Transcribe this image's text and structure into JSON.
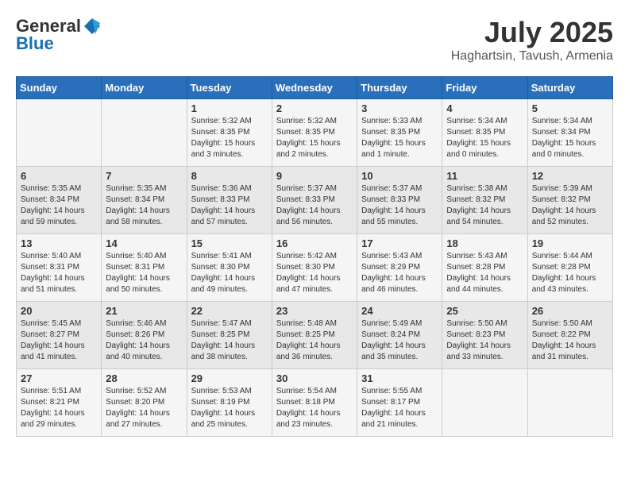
{
  "logo": {
    "general": "General",
    "blue": "Blue"
  },
  "header": {
    "month_year": "July 2025",
    "location": "Haghartsin, Tavush, Armenia"
  },
  "days_of_week": [
    "Sunday",
    "Monday",
    "Tuesday",
    "Wednesday",
    "Thursday",
    "Friday",
    "Saturday"
  ],
  "weeks": [
    [
      {
        "day": "",
        "info": ""
      },
      {
        "day": "",
        "info": ""
      },
      {
        "day": "1",
        "info": "Sunrise: 5:32 AM\nSunset: 8:35 PM\nDaylight: 15 hours and 3 minutes."
      },
      {
        "day": "2",
        "info": "Sunrise: 5:32 AM\nSunset: 8:35 PM\nDaylight: 15 hours and 2 minutes."
      },
      {
        "day": "3",
        "info": "Sunrise: 5:33 AM\nSunset: 8:35 PM\nDaylight: 15 hours and 1 minute."
      },
      {
        "day": "4",
        "info": "Sunrise: 5:34 AM\nSunset: 8:35 PM\nDaylight: 15 hours and 0 minutes."
      },
      {
        "day": "5",
        "info": "Sunrise: 5:34 AM\nSunset: 8:34 PM\nDaylight: 15 hours and 0 minutes."
      }
    ],
    [
      {
        "day": "6",
        "info": "Sunrise: 5:35 AM\nSunset: 8:34 PM\nDaylight: 14 hours and 59 minutes."
      },
      {
        "day": "7",
        "info": "Sunrise: 5:35 AM\nSunset: 8:34 PM\nDaylight: 14 hours and 58 minutes."
      },
      {
        "day": "8",
        "info": "Sunrise: 5:36 AM\nSunset: 8:33 PM\nDaylight: 14 hours and 57 minutes."
      },
      {
        "day": "9",
        "info": "Sunrise: 5:37 AM\nSunset: 8:33 PM\nDaylight: 14 hours and 56 minutes."
      },
      {
        "day": "10",
        "info": "Sunrise: 5:37 AM\nSunset: 8:33 PM\nDaylight: 14 hours and 55 minutes."
      },
      {
        "day": "11",
        "info": "Sunrise: 5:38 AM\nSunset: 8:32 PM\nDaylight: 14 hours and 54 minutes."
      },
      {
        "day": "12",
        "info": "Sunrise: 5:39 AM\nSunset: 8:32 PM\nDaylight: 14 hours and 52 minutes."
      }
    ],
    [
      {
        "day": "13",
        "info": "Sunrise: 5:40 AM\nSunset: 8:31 PM\nDaylight: 14 hours and 51 minutes."
      },
      {
        "day": "14",
        "info": "Sunrise: 5:40 AM\nSunset: 8:31 PM\nDaylight: 14 hours and 50 minutes."
      },
      {
        "day": "15",
        "info": "Sunrise: 5:41 AM\nSunset: 8:30 PM\nDaylight: 14 hours and 49 minutes."
      },
      {
        "day": "16",
        "info": "Sunrise: 5:42 AM\nSunset: 8:30 PM\nDaylight: 14 hours and 47 minutes."
      },
      {
        "day": "17",
        "info": "Sunrise: 5:43 AM\nSunset: 8:29 PM\nDaylight: 14 hours and 46 minutes."
      },
      {
        "day": "18",
        "info": "Sunrise: 5:43 AM\nSunset: 8:28 PM\nDaylight: 14 hours and 44 minutes."
      },
      {
        "day": "19",
        "info": "Sunrise: 5:44 AM\nSunset: 8:28 PM\nDaylight: 14 hours and 43 minutes."
      }
    ],
    [
      {
        "day": "20",
        "info": "Sunrise: 5:45 AM\nSunset: 8:27 PM\nDaylight: 14 hours and 41 minutes."
      },
      {
        "day": "21",
        "info": "Sunrise: 5:46 AM\nSunset: 8:26 PM\nDaylight: 14 hours and 40 minutes."
      },
      {
        "day": "22",
        "info": "Sunrise: 5:47 AM\nSunset: 8:25 PM\nDaylight: 14 hours and 38 minutes."
      },
      {
        "day": "23",
        "info": "Sunrise: 5:48 AM\nSunset: 8:25 PM\nDaylight: 14 hours and 36 minutes."
      },
      {
        "day": "24",
        "info": "Sunrise: 5:49 AM\nSunset: 8:24 PM\nDaylight: 14 hours and 35 minutes."
      },
      {
        "day": "25",
        "info": "Sunrise: 5:50 AM\nSunset: 8:23 PM\nDaylight: 14 hours and 33 minutes."
      },
      {
        "day": "26",
        "info": "Sunrise: 5:50 AM\nSunset: 8:22 PM\nDaylight: 14 hours and 31 minutes."
      }
    ],
    [
      {
        "day": "27",
        "info": "Sunrise: 5:51 AM\nSunset: 8:21 PM\nDaylight: 14 hours and 29 minutes."
      },
      {
        "day": "28",
        "info": "Sunrise: 5:52 AM\nSunset: 8:20 PM\nDaylight: 14 hours and 27 minutes."
      },
      {
        "day": "29",
        "info": "Sunrise: 5:53 AM\nSunset: 8:19 PM\nDaylight: 14 hours and 25 minutes."
      },
      {
        "day": "30",
        "info": "Sunrise: 5:54 AM\nSunset: 8:18 PM\nDaylight: 14 hours and 23 minutes."
      },
      {
        "day": "31",
        "info": "Sunrise: 5:55 AM\nSunset: 8:17 PM\nDaylight: 14 hours and 21 minutes."
      },
      {
        "day": "",
        "info": ""
      },
      {
        "day": "",
        "info": ""
      }
    ]
  ]
}
